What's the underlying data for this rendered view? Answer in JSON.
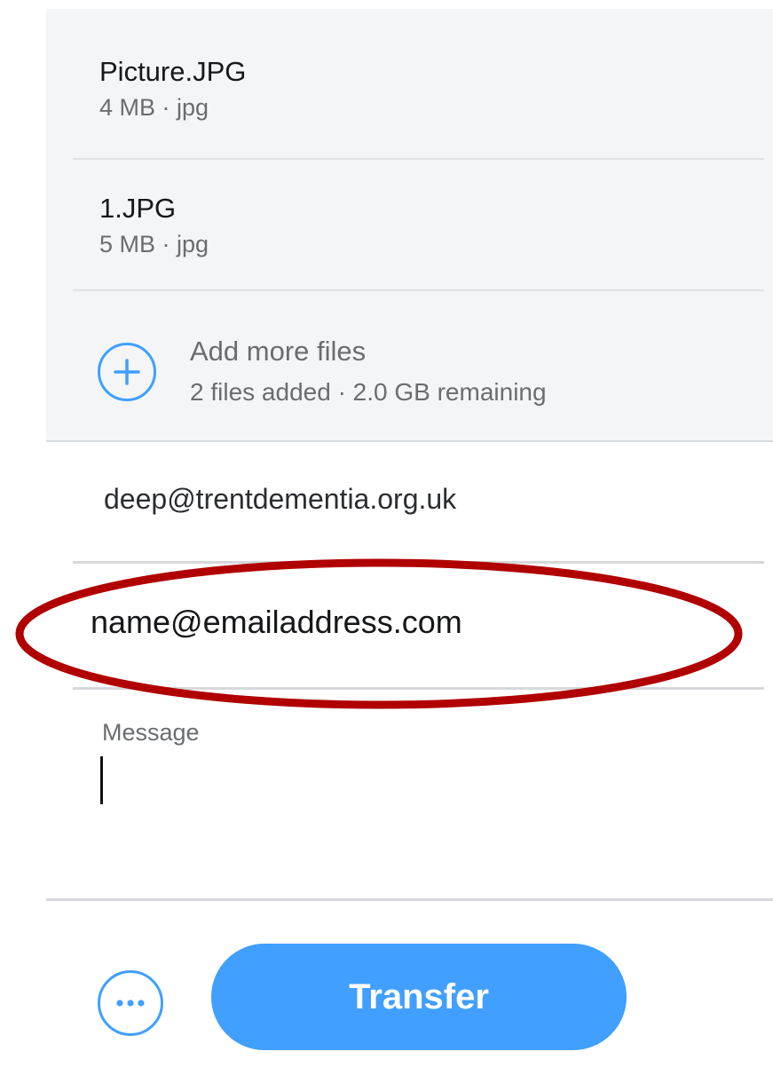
{
  "files": [
    {
      "name": "Picture.JPG",
      "meta": "4 MB · jpg"
    },
    {
      "name": "1.JPG",
      "meta": "5 MB · jpg"
    }
  ],
  "add_more": {
    "title": "Add more files",
    "subtitle": "2 files added · 2.0 GB remaining",
    "icon": "plus-circle-icon"
  },
  "form": {
    "sender_email": "deep@trentdementia.org.uk",
    "recipient_email": "name@emailaddress.com",
    "message_label": "Message",
    "message_value": ""
  },
  "actions": {
    "more_icon": "ellipsis-circle-icon",
    "transfer_label": "Transfer"
  },
  "colors": {
    "accent": "#409fff",
    "highlight": "#b00000",
    "panel_bg": "#f4f5f7"
  }
}
